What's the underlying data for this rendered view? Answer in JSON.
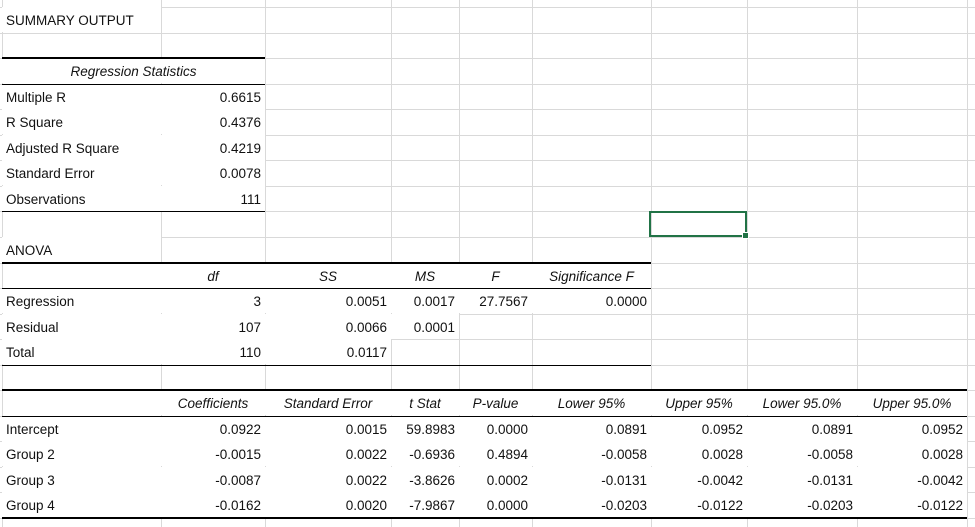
{
  "title": "SUMMARY OUTPUT",
  "regression_statistics": {
    "header": "Regression Statistics",
    "rows": [
      {
        "label": "Multiple R",
        "value": "0.6615"
      },
      {
        "label": "R Square",
        "value": "0.4376"
      },
      {
        "label": "Adjusted R Square",
        "value": "0.4219"
      },
      {
        "label": "Standard Error",
        "value": "0.0078"
      },
      {
        "label": "Observations",
        "value": "111"
      }
    ]
  },
  "anova": {
    "title": "ANOVA",
    "headers": [
      "",
      "df",
      "SS",
      "MS",
      "F",
      "Significance F"
    ],
    "rows": [
      [
        "Regression",
        "3",
        "0.0051",
        "0.0017",
        "27.7567",
        "0.0000"
      ],
      [
        "Residual",
        "107",
        "0.0066",
        "0.0001",
        "",
        ""
      ],
      [
        "Total",
        "110",
        "0.0117",
        "",
        "",
        ""
      ]
    ]
  },
  "coefficients": {
    "headers": [
      "",
      "Coefficients",
      "Standard Error",
      "t Stat",
      "P-value",
      "Lower 95%",
      "Upper 95%",
      "Lower 95.0%",
      "Upper 95.0%"
    ],
    "rows": [
      [
        "Intercept",
        "0.0922",
        "0.0015",
        "59.8983",
        "0.0000",
        "0.0891",
        "0.0952",
        "0.0891",
        "0.0952"
      ],
      [
        "Group 2",
        "-0.0015",
        "0.0022",
        "-0.6936",
        "0.4894",
        "-0.0058",
        "0.0028",
        "-0.0058",
        "0.0028"
      ],
      [
        "Group 3",
        "-0.0087",
        "0.0022",
        "-3.8626",
        "0.0002",
        "-0.0131",
        "-0.0042",
        "-0.0131",
        "-0.0042"
      ],
      [
        "Group 4",
        "-0.0162",
        "0.0020",
        "-7.9867",
        "0.0000",
        "-0.0203",
        "-0.0122",
        "-0.0203",
        "-0.0122"
      ]
    ]
  },
  "colors": {
    "selection": "#217346",
    "gridline": "#d9d9d9"
  }
}
